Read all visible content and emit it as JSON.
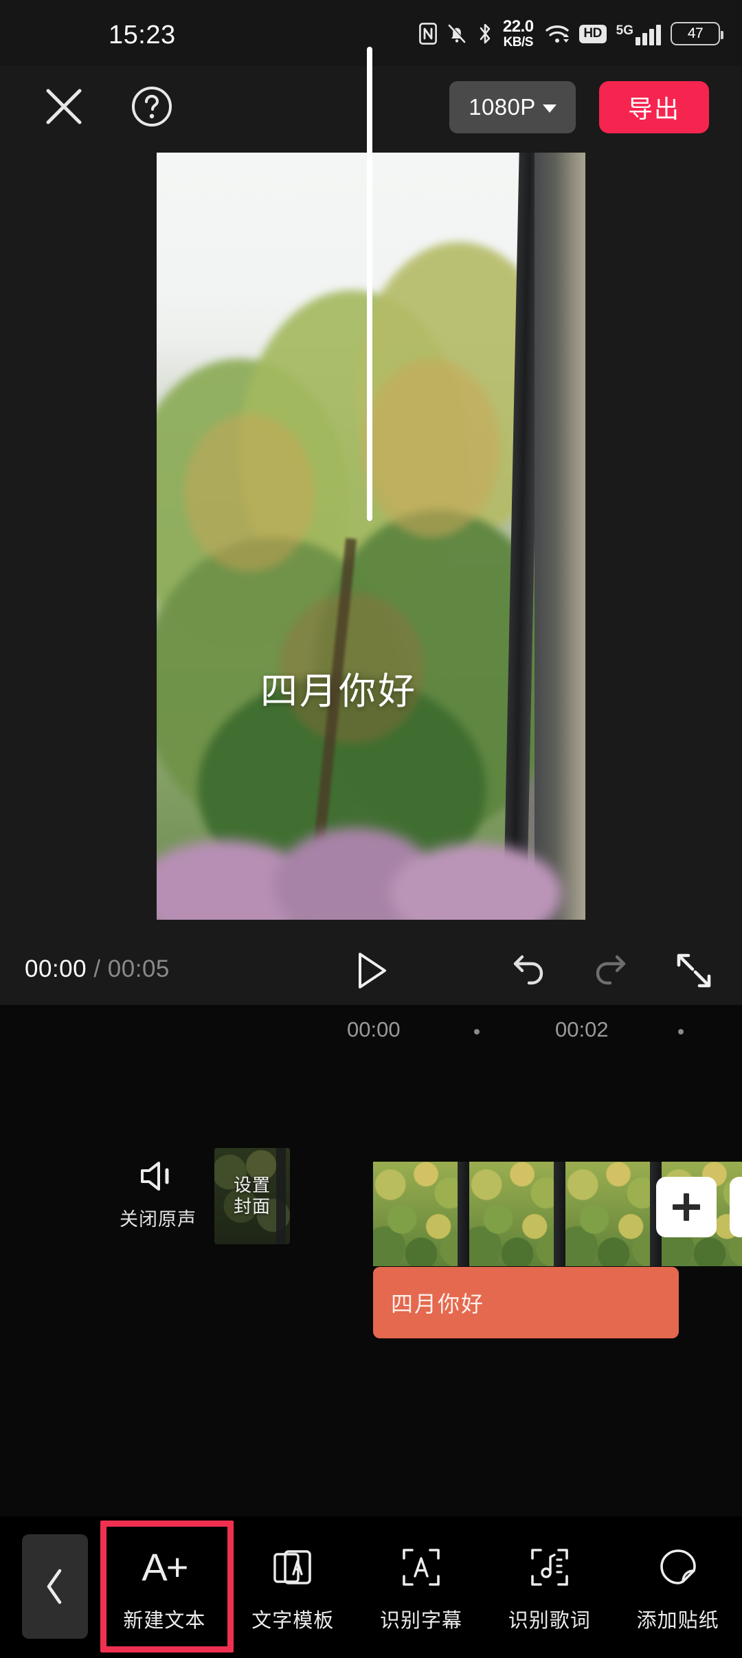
{
  "statusbar": {
    "time": "15:23",
    "net_speed_value": "22.0",
    "net_speed_unit": "KB/S",
    "hd_label": "HD",
    "network_type": "5G",
    "battery_level": "47",
    "icons": [
      "nfc-icon",
      "bell-muted-icon",
      "bluetooth-icon",
      "wifi-icon",
      "hd-icon",
      "signal-icon",
      "battery-icon"
    ]
  },
  "toolbar": {
    "close_icon": "close-icon",
    "help_icon": "help-icon",
    "resolution_label": "1080P",
    "resolution_caret": "chevron-down-icon",
    "export_label": "导出",
    "export_color": "#f5254f"
  },
  "preview": {
    "overlay_text": "四月你好"
  },
  "playback": {
    "current_time": "00:00",
    "separator": "/",
    "total_time": "00:05",
    "play_icon": "play-icon",
    "undo_icon": "undo-icon",
    "redo_icon": "redo-icon",
    "fullscreen_icon": "fullscreen-icon"
  },
  "timeline": {
    "ruler_labels": [
      "00:00",
      "00:02"
    ],
    "mute_label": "关闭原声",
    "mute_icon": "speaker-mute-icon",
    "cover_label": "设置\n封面",
    "cover_label_line1": "设置",
    "cover_label_line2": "封面",
    "add_clip_icon": "plus-icon",
    "text_clip_label": "四月你好",
    "text_clip_color": "#e4694f",
    "playhead_position": "00:00"
  },
  "bottombar": {
    "back_icon": "chevron-left-icon",
    "highlight_color": "#ef3050",
    "items": [
      {
        "label": "新建文本",
        "icon": "add-text-icon",
        "glyph": "A+",
        "highlighted": true
      },
      {
        "label": "文字模板",
        "icon": "text-template-icon",
        "highlighted": false
      },
      {
        "label": "识别字幕",
        "icon": "auto-captions-icon",
        "highlighted": false
      },
      {
        "label": "识别歌词",
        "icon": "auto-lyrics-icon",
        "highlighted": false
      },
      {
        "label": "添加贴纸",
        "icon": "sticker-icon",
        "highlighted": false
      }
    ]
  }
}
